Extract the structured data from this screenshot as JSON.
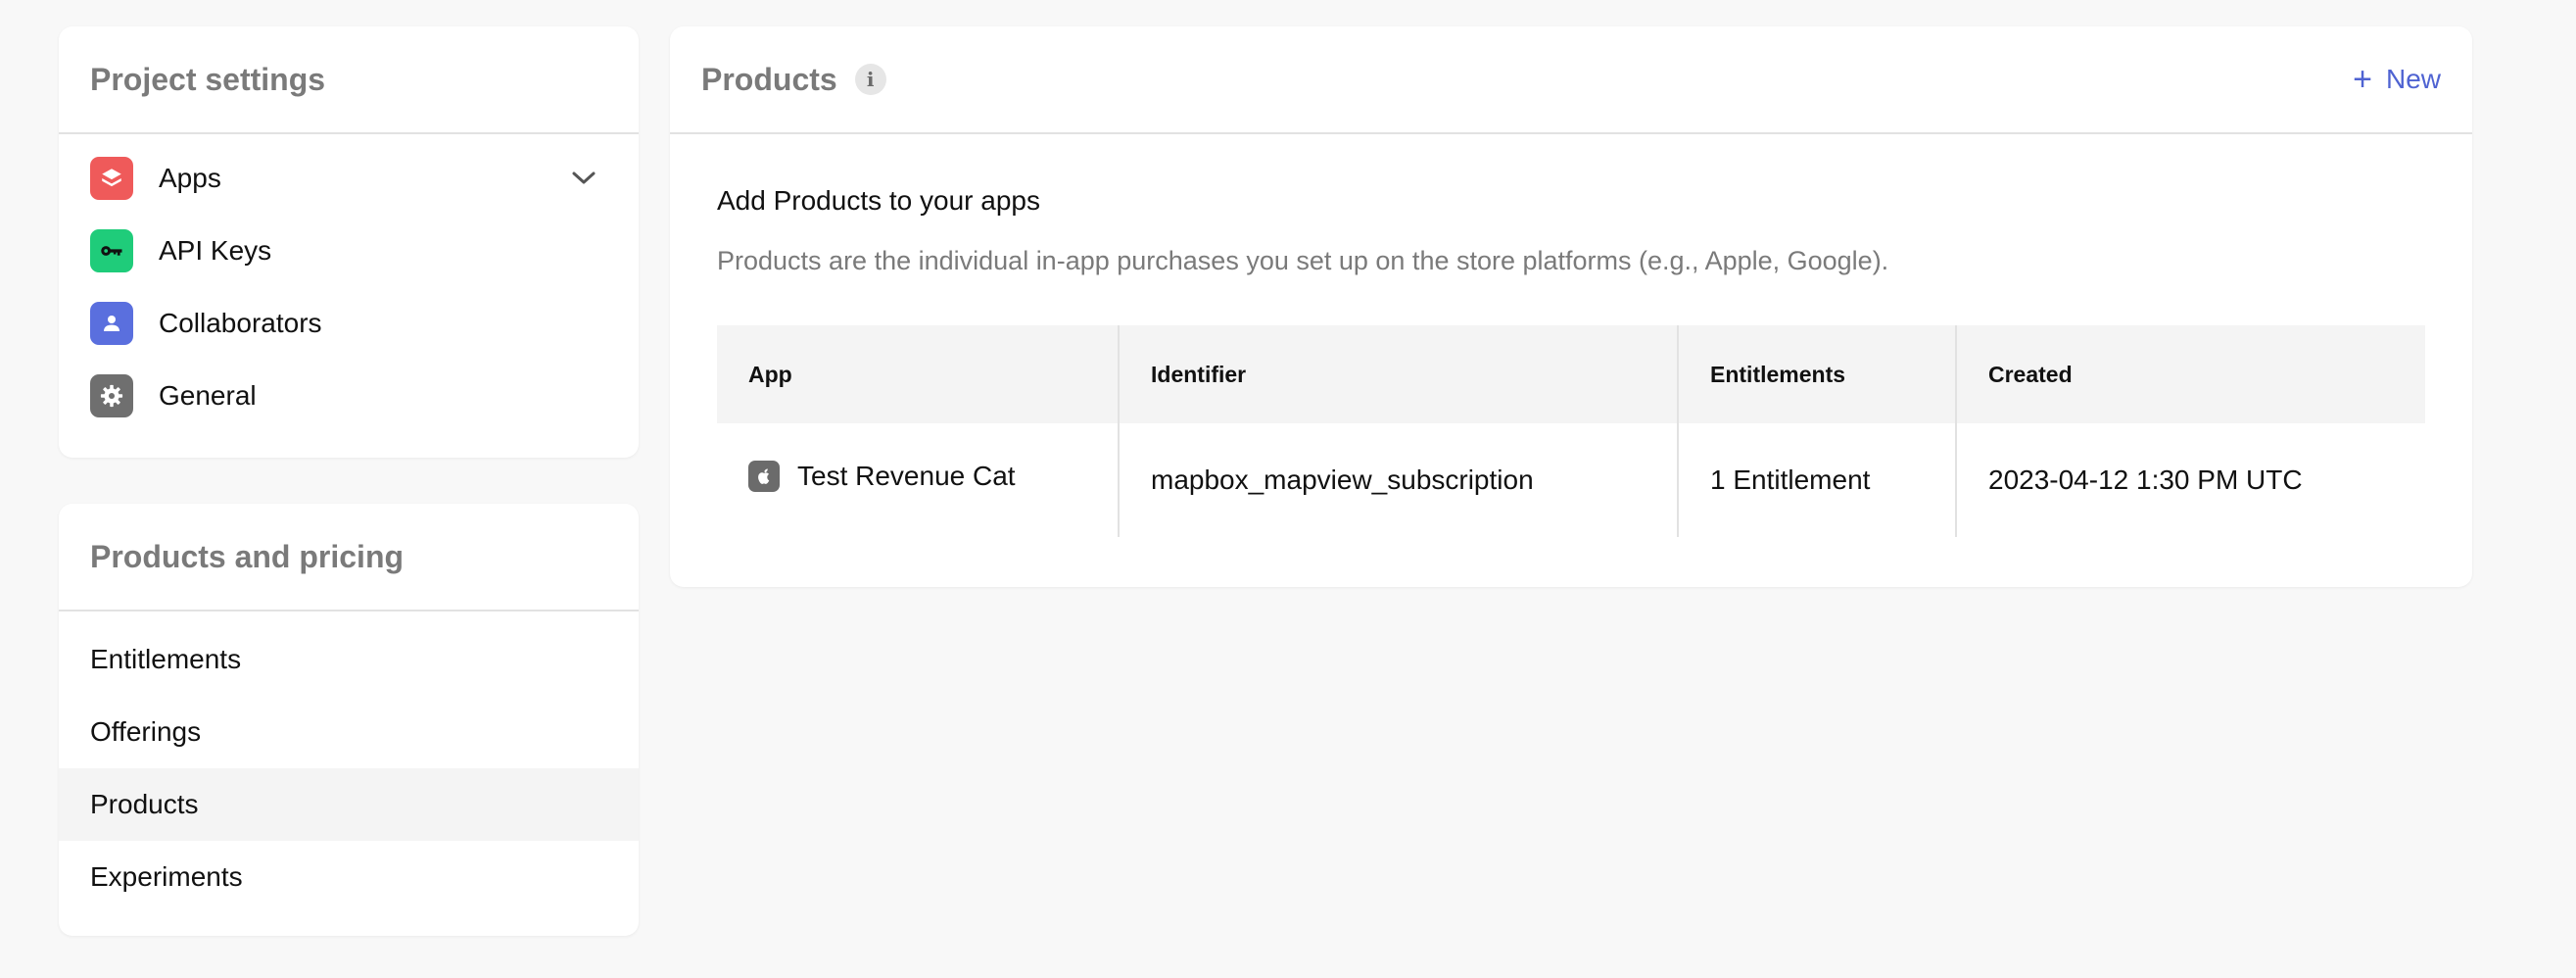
{
  "project_settings": {
    "title": "Project settings",
    "items": [
      {
        "label": "Apps",
        "icon": "layers-icon",
        "color": "#ef5a5a",
        "has_chevron": true
      },
      {
        "label": "API Keys",
        "icon": "key-icon",
        "color": "#1fcc7a"
      },
      {
        "label": "Collaborators",
        "icon": "person-icon",
        "color": "#5a6fde"
      },
      {
        "label": "General",
        "icon": "gear-icon",
        "color": "#6f6f6f"
      }
    ]
  },
  "products_pricing": {
    "title": "Products and pricing",
    "items": [
      {
        "label": "Entitlements"
      },
      {
        "label": "Offerings"
      },
      {
        "label": "Products",
        "active": true
      },
      {
        "label": "Experiments"
      }
    ]
  },
  "main": {
    "title": "Products",
    "info_icon": "i",
    "new_button_icon": "+",
    "new_button_label": "New",
    "subhead": "Add Products to your apps",
    "description": "Products are the individual in-app purchases you set up on the store platforms (e.g., Apple, Google).",
    "table": {
      "headers": [
        "App",
        "Identifier",
        "Entitlements",
        "Created"
      ],
      "rows": [
        {
          "app": "Test Revenue Cat",
          "app_icon": "apple-icon",
          "identifier": "mapbox_mapview_subscription",
          "entitlements": "1 Entitlement",
          "created": "2023-04-12 1:30 PM UTC"
        }
      ]
    }
  },
  "colors": {
    "accent": "#4f63d2",
    "background": "#f8f8f8",
    "card": "#ffffff"
  }
}
